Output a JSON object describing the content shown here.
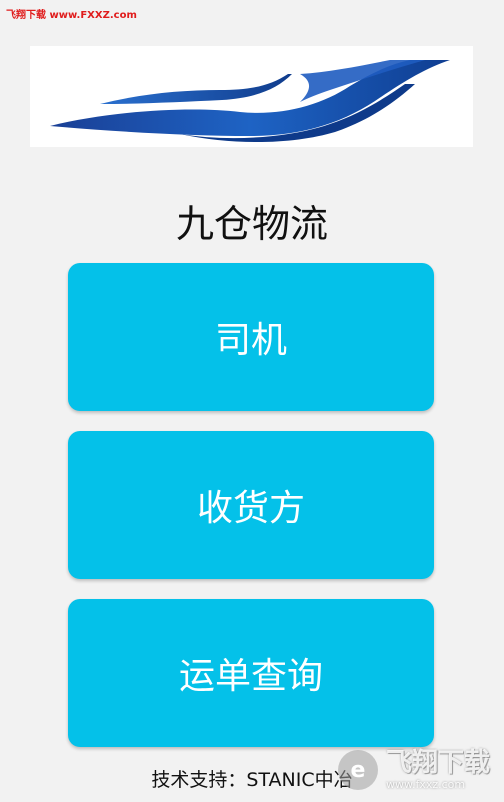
{
  "watermark": {
    "top_left": "飞翔下载 www.FXXZ.com",
    "bottom_right_main": "飞翔下载",
    "bottom_right_sub": "www.fxxz.com"
  },
  "app": {
    "title": "九仓物流"
  },
  "menu": {
    "driver_label": "司机",
    "consignee_label": "收货方",
    "waybill_query_label": "运单查询"
  },
  "footer": {
    "support_text": "技术支持：STANIC中冶"
  },
  "colors": {
    "button_bg": "#04c1e9",
    "logo_blue": "#1a55b0",
    "background": "#f2f2f2",
    "watermark_red": "#e01c1c"
  }
}
